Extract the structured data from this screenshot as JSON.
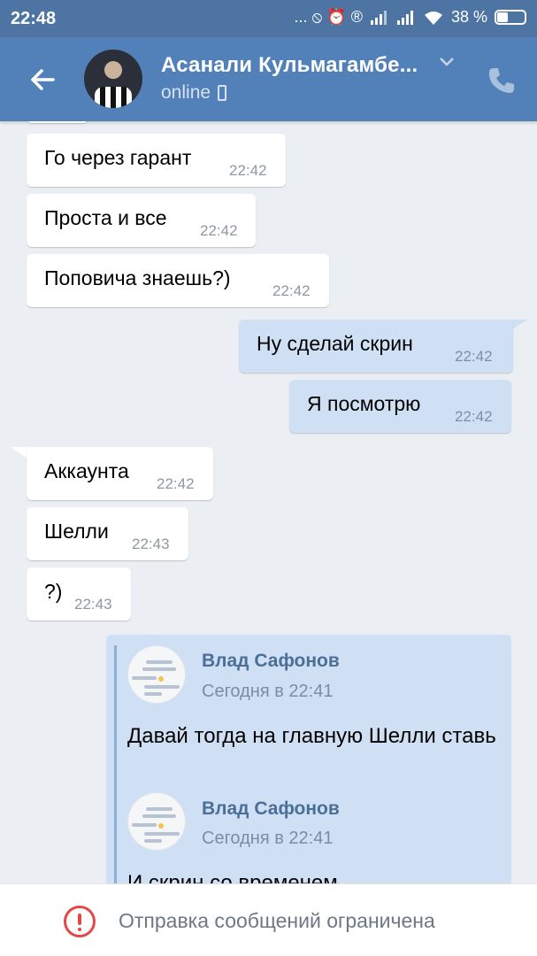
{
  "status_bar": {
    "time": "22:48",
    "icons_text": "... ⦸ ⏰ ®",
    "battery": "38 %"
  },
  "header": {
    "contact_name": "Асанали Кульмагамбе...",
    "status": "online",
    "icons": [
      "back-arrow-icon",
      "chevron-down-icon",
      "mobile-icon",
      "phone-call-icon"
    ]
  },
  "messages": [
    {
      "dir": "in",
      "text": "Го через гарант",
      "time": "22:42"
    },
    {
      "dir": "in",
      "text": "Проста и все",
      "time": "22:42"
    },
    {
      "dir": "in",
      "text": "Поповича знаешь?)",
      "time": "22:42"
    },
    {
      "dir": "out",
      "text": "Ну сделай скрин",
      "time": "22:42"
    },
    {
      "dir": "out",
      "text": "Я посмотрю",
      "time": "22:42"
    },
    {
      "dir": "in",
      "text": "Аккаунта",
      "time": "22:42"
    },
    {
      "dir": "in",
      "text": "Шелли",
      "time": "22:43"
    },
    {
      "dir": "in",
      "text": "?)",
      "time": "22:43"
    }
  ],
  "forwarded": [
    {
      "author": "Влад Сафонов",
      "date": "Сегодня в 22:41",
      "text": "Давай тогда на главную Шелли ставь"
    },
    {
      "author": "Влад Сафонов",
      "date": "Сегодня в 22:41",
      "text": "И скрин со временем"
    }
  ],
  "bottom_bar": {
    "text": "Отправка сообщений ограничена"
  },
  "colors": {
    "header": "#5181b8",
    "statusbar": "#4d74a3",
    "bg": "#ebeef2",
    "outgoing": "#cfe0f5",
    "incoming": "#ffffff",
    "warning": "#e64646"
  }
}
